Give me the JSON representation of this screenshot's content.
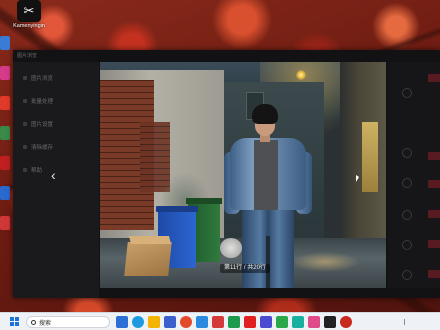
{
  "desktop": {
    "capcut_icon_label": "CapCut",
    "capcut_icon_sublabel": "Kamenyingin"
  },
  "viewer": {
    "window_title": "图片浏览",
    "menu": [
      {
        "label": "图片浏览"
      },
      {
        "label": "批量处理"
      },
      {
        "label": "图片设置"
      },
      {
        "label": "清除缓存"
      },
      {
        "label": "帮助"
      }
    ],
    "prev_arrow": "‹",
    "counter_text": "第11行 / 共20行"
  },
  "taskbar": {
    "search_placeholder": "搜索",
    "colors": {
      "start": "#1a73d9",
      "background": "#eef1f6"
    }
  }
}
